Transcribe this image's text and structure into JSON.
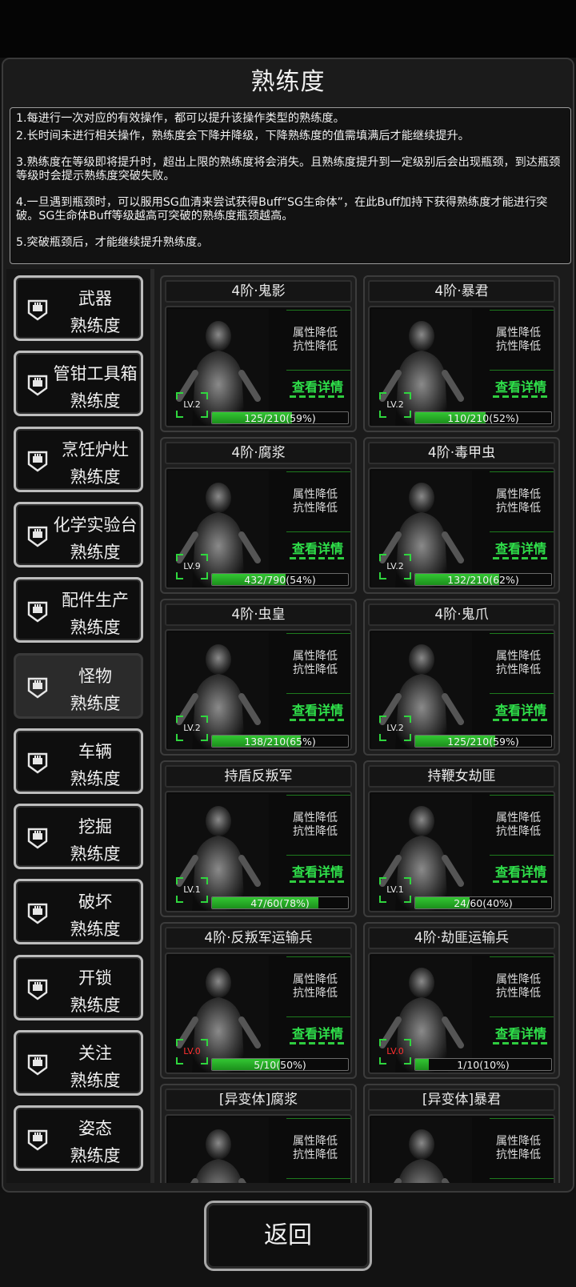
{
  "title": "熟练度",
  "info": [
    "1.每进行一次对应的有效操作，都可以提升该操作类型的熟练度。",
    "2.长时间未进行相关操作，熟练度会下降并降级，下降熟练度的值需填满后才能继续提升。",
    "3.熟练度在等级即将提升时，超出上限的熟练度将会消失。且熟练度提升到一定级别后会出现瓶颈，到达瓶颈等级时会提示熟练度突破失败。",
    "4.一旦遇到瓶颈时，可以服用SG血清来尝试获得Buff“SG生命体”，在此Buff加持下获得熟练度才能进行突破。SG生命体Buff等级越高可突破的熟练度瓶颈越高。",
    "5.突破瓶颈后，才能继续提升熟练度。"
  ],
  "categories": [
    {
      "line1": "武器",
      "line2": "熟练度",
      "icon": "badge-icon"
    },
    {
      "line1": "管钳工具箱",
      "line2": "熟练度",
      "icon": "badge-icon"
    },
    {
      "line1": "烹饪炉灶",
      "line2": "熟练度",
      "icon": "badge-icon"
    },
    {
      "line1": "化学实验台",
      "line2": "熟练度",
      "icon": "badge-icon"
    },
    {
      "line1": "配件生产",
      "line2": "熟练度",
      "icon": "badge-icon"
    },
    {
      "line1": "怪物",
      "line2": "熟练度",
      "icon": "badge-icon",
      "active": true
    },
    {
      "line1": "车辆",
      "line2": "熟练度",
      "icon": "badge-icon"
    },
    {
      "line1": "挖掘",
      "line2": "熟练度",
      "icon": "badge-icon"
    },
    {
      "line1": "破坏",
      "line2": "熟练度",
      "icon": "badge-icon"
    },
    {
      "line1": "开锁",
      "line2": "熟练度",
      "icon": "badge-icon"
    },
    {
      "line1": "关注",
      "line2": "熟练度",
      "icon": "badge-icon"
    },
    {
      "line1": "姿态",
      "line2": "熟练度",
      "icon": "badge-icon"
    }
  ],
  "attr_line1": "属性降低",
  "attr_line2": "抗性降低",
  "detail_label": "查看详情",
  "cards": [
    {
      "name": "4阶·鬼影",
      "level": "LV.2",
      "progress": "125/210(59%)",
      "fill": 0.59
    },
    {
      "name": "4阶·暴君",
      "level": "LV.2",
      "progress": "110/210(52%)",
      "fill": 0.52
    },
    {
      "name": "4阶·腐浆",
      "level": "LV.9",
      "progress": "432/790(54%)",
      "fill": 0.54
    },
    {
      "name": "4阶·毒甲虫",
      "level": "LV.2",
      "progress": "132/210(62%)",
      "fill": 0.62
    },
    {
      "name": "4阶·虫皇",
      "level": "LV.2",
      "progress": "138/210(65%)",
      "fill": 0.65
    },
    {
      "name": "4阶·鬼爪",
      "level": "LV.2",
      "progress": "125/210(59%)",
      "fill": 0.59
    },
    {
      "name": "持盾反叛军",
      "level": "LV.1",
      "progress": "47/60(78%)",
      "fill": 0.78
    },
    {
      "name": "持鞭女劫匪",
      "level": "LV.1",
      "progress": "24/60(40%)",
      "fill": 0.4
    },
    {
      "name": "4阶·反叛军运输兵",
      "level": "LV.0",
      "progress": "5/10(50%)",
      "fill": 0.5
    },
    {
      "name": "4阶·劫匪运输兵",
      "level": "LV.0",
      "progress": "1/10(10%)",
      "fill": 0.1
    },
    {
      "name": "[异变体]腐浆",
      "level": "",
      "progress": "",
      "fill": 0
    },
    {
      "name": "[异变体]暴君",
      "level": "",
      "progress": "",
      "fill": 0
    }
  ],
  "back_label": "返回"
}
